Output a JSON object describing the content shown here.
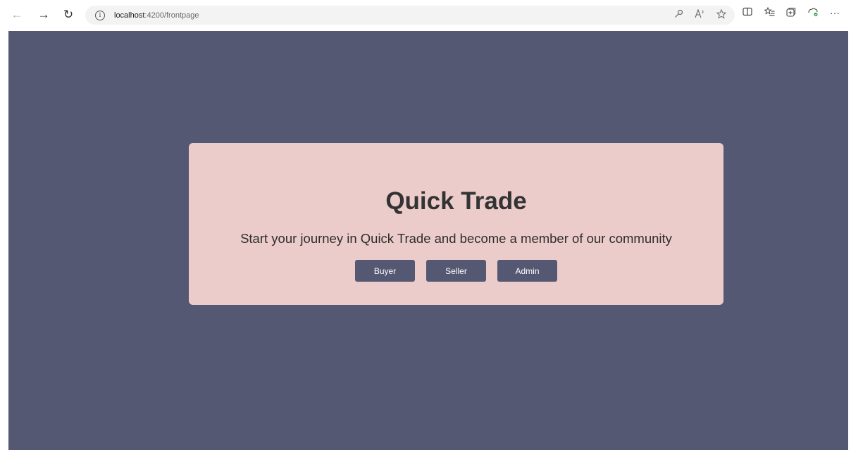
{
  "browser": {
    "url_host": "localhost",
    "url_path": ":4200/frontpage",
    "back_glyph": "←",
    "forward_glyph": "→",
    "refresh_glyph": "↻",
    "info_glyph": "i",
    "ellipsis_glyph": "···"
  },
  "page": {
    "title": "Quick Trade",
    "subtitle": "Start your journey in Quick Trade and become a member of our community",
    "buttons": {
      "buyer": "Buyer",
      "seller": "Seller",
      "admin": "Admin"
    }
  },
  "colors": {
    "background": "#545872",
    "card": "#ecccca",
    "button": "#545872",
    "title": "#333333"
  }
}
